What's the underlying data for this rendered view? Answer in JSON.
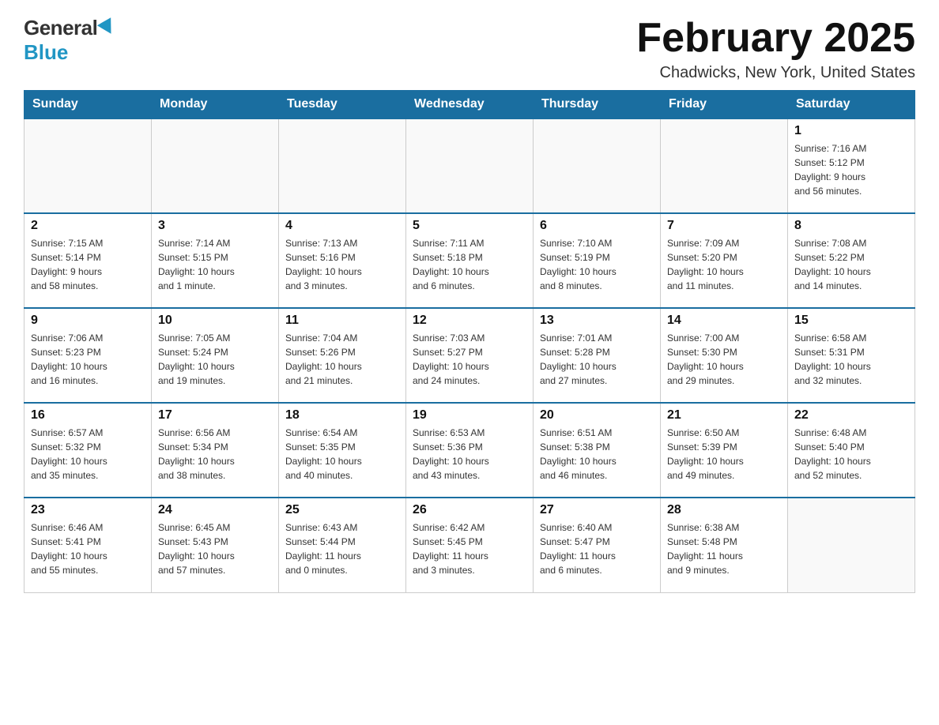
{
  "logo": {
    "general": "General",
    "blue": "Blue"
  },
  "title": {
    "month": "February 2025",
    "location": "Chadwicks, New York, United States"
  },
  "weekdays": [
    "Sunday",
    "Monday",
    "Tuesday",
    "Wednesday",
    "Thursday",
    "Friday",
    "Saturday"
  ],
  "weeks": [
    [
      {
        "day": "",
        "info": ""
      },
      {
        "day": "",
        "info": ""
      },
      {
        "day": "",
        "info": ""
      },
      {
        "day": "",
        "info": ""
      },
      {
        "day": "",
        "info": ""
      },
      {
        "day": "",
        "info": ""
      },
      {
        "day": "1",
        "info": "Sunrise: 7:16 AM\nSunset: 5:12 PM\nDaylight: 9 hours\nand 56 minutes."
      }
    ],
    [
      {
        "day": "2",
        "info": "Sunrise: 7:15 AM\nSunset: 5:14 PM\nDaylight: 9 hours\nand 58 minutes."
      },
      {
        "day": "3",
        "info": "Sunrise: 7:14 AM\nSunset: 5:15 PM\nDaylight: 10 hours\nand 1 minute."
      },
      {
        "day": "4",
        "info": "Sunrise: 7:13 AM\nSunset: 5:16 PM\nDaylight: 10 hours\nand 3 minutes."
      },
      {
        "day": "5",
        "info": "Sunrise: 7:11 AM\nSunset: 5:18 PM\nDaylight: 10 hours\nand 6 minutes."
      },
      {
        "day": "6",
        "info": "Sunrise: 7:10 AM\nSunset: 5:19 PM\nDaylight: 10 hours\nand 8 minutes."
      },
      {
        "day": "7",
        "info": "Sunrise: 7:09 AM\nSunset: 5:20 PM\nDaylight: 10 hours\nand 11 minutes."
      },
      {
        "day": "8",
        "info": "Sunrise: 7:08 AM\nSunset: 5:22 PM\nDaylight: 10 hours\nand 14 minutes."
      }
    ],
    [
      {
        "day": "9",
        "info": "Sunrise: 7:06 AM\nSunset: 5:23 PM\nDaylight: 10 hours\nand 16 minutes."
      },
      {
        "day": "10",
        "info": "Sunrise: 7:05 AM\nSunset: 5:24 PM\nDaylight: 10 hours\nand 19 minutes."
      },
      {
        "day": "11",
        "info": "Sunrise: 7:04 AM\nSunset: 5:26 PM\nDaylight: 10 hours\nand 21 minutes."
      },
      {
        "day": "12",
        "info": "Sunrise: 7:03 AM\nSunset: 5:27 PM\nDaylight: 10 hours\nand 24 minutes."
      },
      {
        "day": "13",
        "info": "Sunrise: 7:01 AM\nSunset: 5:28 PM\nDaylight: 10 hours\nand 27 minutes."
      },
      {
        "day": "14",
        "info": "Sunrise: 7:00 AM\nSunset: 5:30 PM\nDaylight: 10 hours\nand 29 minutes."
      },
      {
        "day": "15",
        "info": "Sunrise: 6:58 AM\nSunset: 5:31 PM\nDaylight: 10 hours\nand 32 minutes."
      }
    ],
    [
      {
        "day": "16",
        "info": "Sunrise: 6:57 AM\nSunset: 5:32 PM\nDaylight: 10 hours\nand 35 minutes."
      },
      {
        "day": "17",
        "info": "Sunrise: 6:56 AM\nSunset: 5:34 PM\nDaylight: 10 hours\nand 38 minutes."
      },
      {
        "day": "18",
        "info": "Sunrise: 6:54 AM\nSunset: 5:35 PM\nDaylight: 10 hours\nand 40 minutes."
      },
      {
        "day": "19",
        "info": "Sunrise: 6:53 AM\nSunset: 5:36 PM\nDaylight: 10 hours\nand 43 minutes."
      },
      {
        "day": "20",
        "info": "Sunrise: 6:51 AM\nSunset: 5:38 PM\nDaylight: 10 hours\nand 46 minutes."
      },
      {
        "day": "21",
        "info": "Sunrise: 6:50 AM\nSunset: 5:39 PM\nDaylight: 10 hours\nand 49 minutes."
      },
      {
        "day": "22",
        "info": "Sunrise: 6:48 AM\nSunset: 5:40 PM\nDaylight: 10 hours\nand 52 minutes."
      }
    ],
    [
      {
        "day": "23",
        "info": "Sunrise: 6:46 AM\nSunset: 5:41 PM\nDaylight: 10 hours\nand 55 minutes."
      },
      {
        "day": "24",
        "info": "Sunrise: 6:45 AM\nSunset: 5:43 PM\nDaylight: 10 hours\nand 57 minutes."
      },
      {
        "day": "25",
        "info": "Sunrise: 6:43 AM\nSunset: 5:44 PM\nDaylight: 11 hours\nand 0 minutes."
      },
      {
        "day": "26",
        "info": "Sunrise: 6:42 AM\nSunset: 5:45 PM\nDaylight: 11 hours\nand 3 minutes."
      },
      {
        "day": "27",
        "info": "Sunrise: 6:40 AM\nSunset: 5:47 PM\nDaylight: 11 hours\nand 6 minutes."
      },
      {
        "day": "28",
        "info": "Sunrise: 6:38 AM\nSunset: 5:48 PM\nDaylight: 11 hours\nand 9 minutes."
      },
      {
        "day": "",
        "info": ""
      }
    ]
  ]
}
